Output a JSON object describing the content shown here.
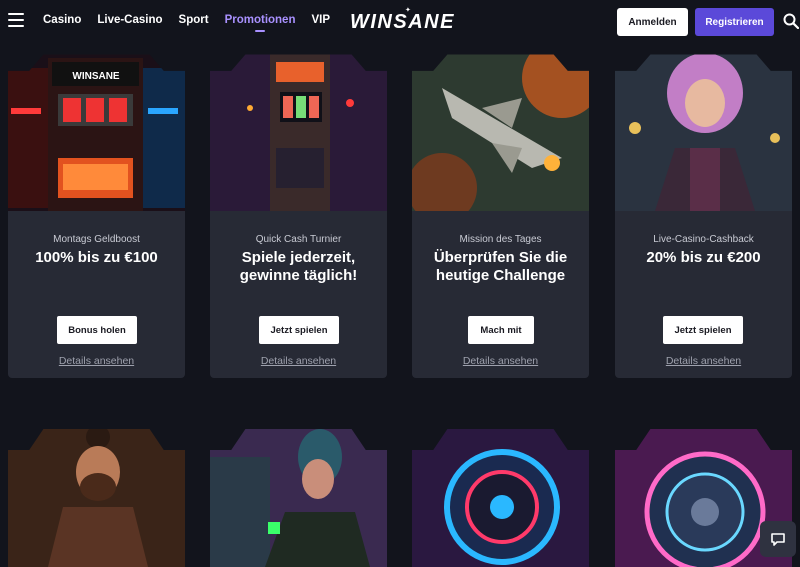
{
  "header": {
    "logo": "WINSANE",
    "nav": [
      "Casino",
      "Live-Casino",
      "Sport",
      "Promotionen",
      "VIP"
    ],
    "active_nav": "Promotionen",
    "login_label": "Anmelden",
    "register_label": "Registrieren"
  },
  "promotions": [
    {
      "subtitle": "Montags Geldboost",
      "title": "100% bis zu €100",
      "button": "Bonus holen",
      "link": "Details ansehen",
      "image": "slot-machine-neon-winsane"
    },
    {
      "subtitle": "Quick Cash Turnier",
      "title": "Spiele jederzeit, gewinne täglich!",
      "button": "Jetzt spielen",
      "link": "Details ansehen",
      "image": "slot-machine-purple"
    },
    {
      "subtitle": "Mission des Tages",
      "title": "Überprüfen Sie die heutige Challenge",
      "button": "Mach mit",
      "link": "Details ansehen",
      "image": "fighter-jet"
    },
    {
      "subtitle": "Live-Casino-Cashback",
      "title": "20% bis zu €200",
      "button": "Jetzt spielen",
      "link": "Details ansehen",
      "image": "pink-haired-woman"
    }
  ],
  "second_row_images": [
    "bearded-man-cards",
    "cyber-girl-green",
    "neon-wheel-blue",
    "neon-wheel-pink"
  ],
  "colors": {
    "background": "#12141c",
    "card": "#272a35",
    "accent": "#5b49d9",
    "active_nav": "#a991ff"
  }
}
